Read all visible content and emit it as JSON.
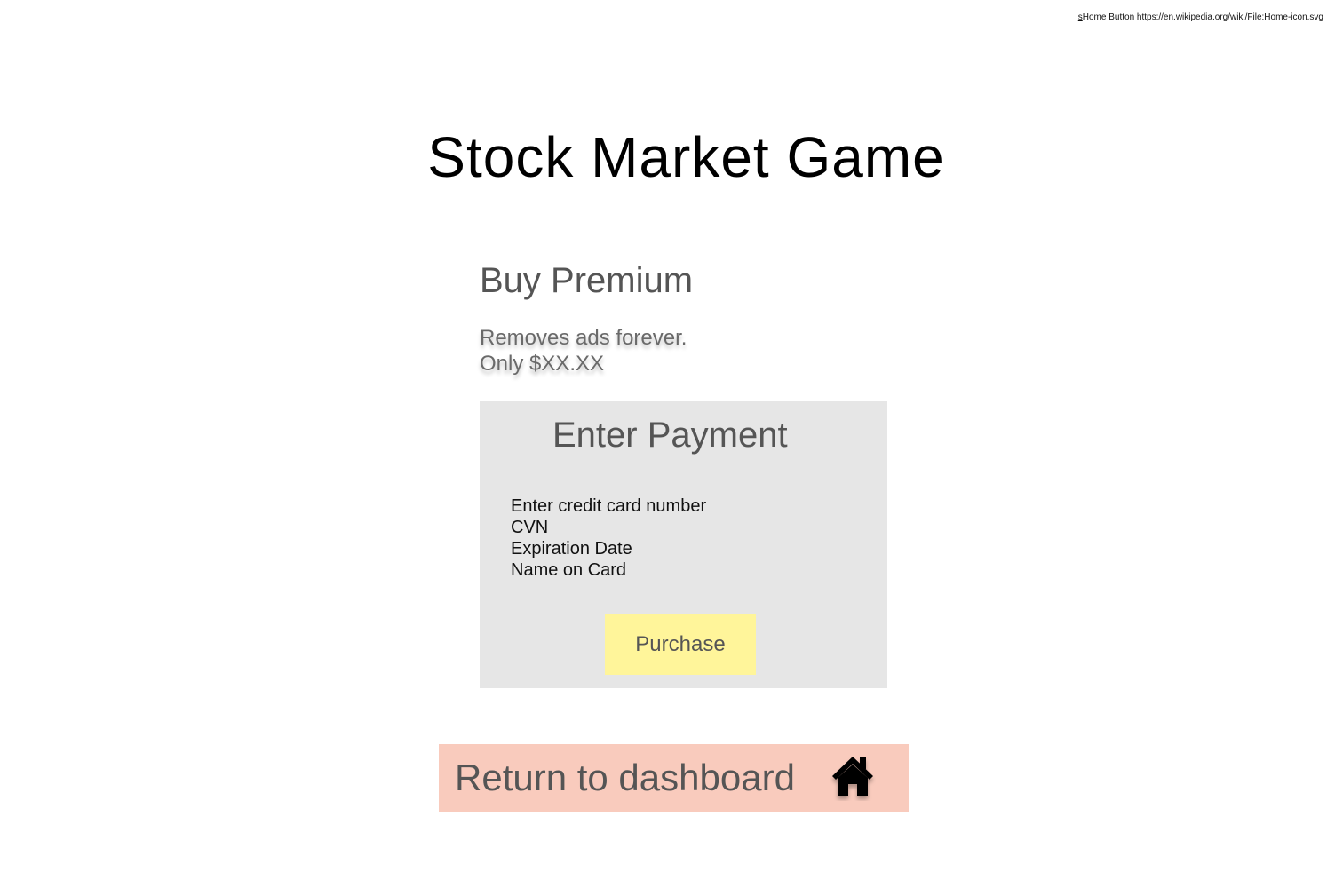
{
  "credit": {
    "prefix": "s",
    "text": "Home Button https://en.wikipedia.org/wiki/File:Home-icon.svg"
  },
  "app": {
    "title": "Stock Market Game"
  },
  "premium": {
    "heading": "Buy Premium",
    "line1": "Removes ads forever.",
    "line2": "Only $XX.XX"
  },
  "payment": {
    "title": "Enter Payment",
    "fields": [
      {
        "label": "Enter credit card number"
      },
      {
        "label": "CVN"
      },
      {
        "label": "Expiration Date"
      },
      {
        "label": "Name on Card"
      }
    ],
    "purchase_label": "Purchase"
  },
  "footer": {
    "return_label": "Return to dashboard",
    "icon": "home-icon"
  },
  "colors": {
    "payment_card_bg": "#e6e6e6",
    "purchase_button_bg": "#fff59a",
    "return_button_bg": "#f9cbbd"
  }
}
